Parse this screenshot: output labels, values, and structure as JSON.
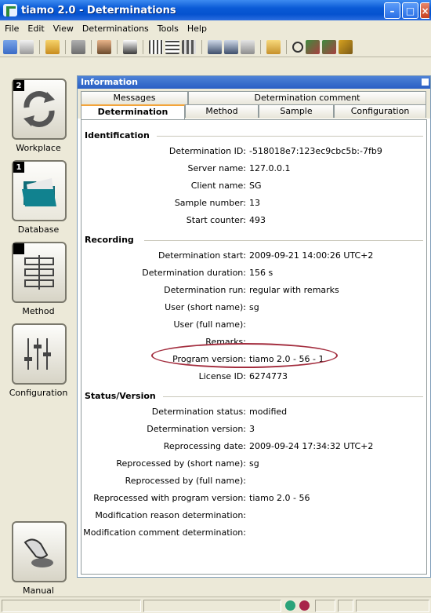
{
  "window": {
    "title": "tiamo 2.0 - Determinations"
  },
  "menu": {
    "items": [
      {
        "label": "File"
      },
      {
        "label": "Edit"
      },
      {
        "label": "View"
      },
      {
        "label": "Determinations"
      },
      {
        "label": "Tools"
      },
      {
        "label": "Help"
      }
    ]
  },
  "toolbar": {
    "icons": [
      "open-icon",
      "print-icon",
      "filter-icon",
      "user-icon",
      "copy-icon",
      "edit-icon",
      "grid-icon",
      "table-icon",
      "report-icon",
      "export-icon",
      "import-icon",
      "chart-icon",
      "folder-icon",
      "search-icon",
      "check-icon",
      "check-all-icon",
      "sign-icon"
    ]
  },
  "nav": {
    "items": [
      {
        "label": "Workplace",
        "number": "2",
        "icon": "arrows-icon"
      },
      {
        "label": "Database",
        "number": "1",
        "icon": "folder-icon"
      },
      {
        "label": "Method",
        "number": "",
        "icon": "method-icon"
      },
      {
        "label": "Configuration",
        "number": "",
        "icon": "sliders-icon"
      },
      {
        "label": "Manual",
        "number": "",
        "icon": "hand-icon"
      }
    ]
  },
  "panel": {
    "title": "Information",
    "tabs_top": [
      {
        "label": "Messages"
      },
      {
        "label": "Determination comment"
      }
    ],
    "tabs_bottom": [
      {
        "label": "Determination",
        "active": true
      },
      {
        "label": "Method",
        "active": false
      },
      {
        "label": "Sample",
        "active": false
      },
      {
        "label": "Configuration",
        "active": false
      }
    ]
  },
  "identification": {
    "heading": "Identification",
    "rows": [
      {
        "label": "Determination ID:",
        "value": "-518018e7:123ec9cbc5b:-7fb9"
      },
      {
        "label": "Server name:",
        "value": "127.0.0.1"
      },
      {
        "label": "Client name:",
        "value": "SG"
      },
      {
        "label": "Sample number:",
        "value": "13"
      },
      {
        "label": "Start counter:",
        "value": "493"
      }
    ]
  },
  "recording": {
    "heading": "Recording",
    "rows": [
      {
        "label": "Determination start:",
        "value": "2009-09-21 14:00:26 UTC+2"
      },
      {
        "label": "Determination duration:",
        "value": "156 s"
      },
      {
        "label": "Determination run:",
        "value": "regular with remarks"
      },
      {
        "label": "User (short name):",
        "value": "sg"
      },
      {
        "label": "User (full name):",
        "value": ""
      },
      {
        "label": "Remarks:",
        "value": ""
      },
      {
        "label": "Program version:",
        "value": "tiamo 2.0 - 56 - 1"
      },
      {
        "label": "License ID:",
        "value": "6274773"
      }
    ]
  },
  "status_version": {
    "heading": "Status/Version",
    "rows": [
      {
        "label": "Determination status:",
        "value": "modified"
      },
      {
        "label": "Determination version:",
        "value": "3"
      },
      {
        "label": "Reprocessing date:",
        "value": "2009-09-24 17:34:32 UTC+2"
      },
      {
        "label": "Reprocessed by (short name):",
        "value": "sg"
      },
      {
        "label": "Reprocessed by (full name):",
        "value": ""
      },
      {
        "label": "Reprocessed with program version:",
        "value": "tiamo 2.0 - 56"
      },
      {
        "label": "Modification reason determination:",
        "value": ""
      },
      {
        "label": "Modification comment determination:",
        "value": ""
      }
    ]
  },
  "colors": {
    "titlebar": "#0a5ad6",
    "highlight": "#a32d3e",
    "led_green": "#2aa37a",
    "led_red": "#a8234a"
  }
}
